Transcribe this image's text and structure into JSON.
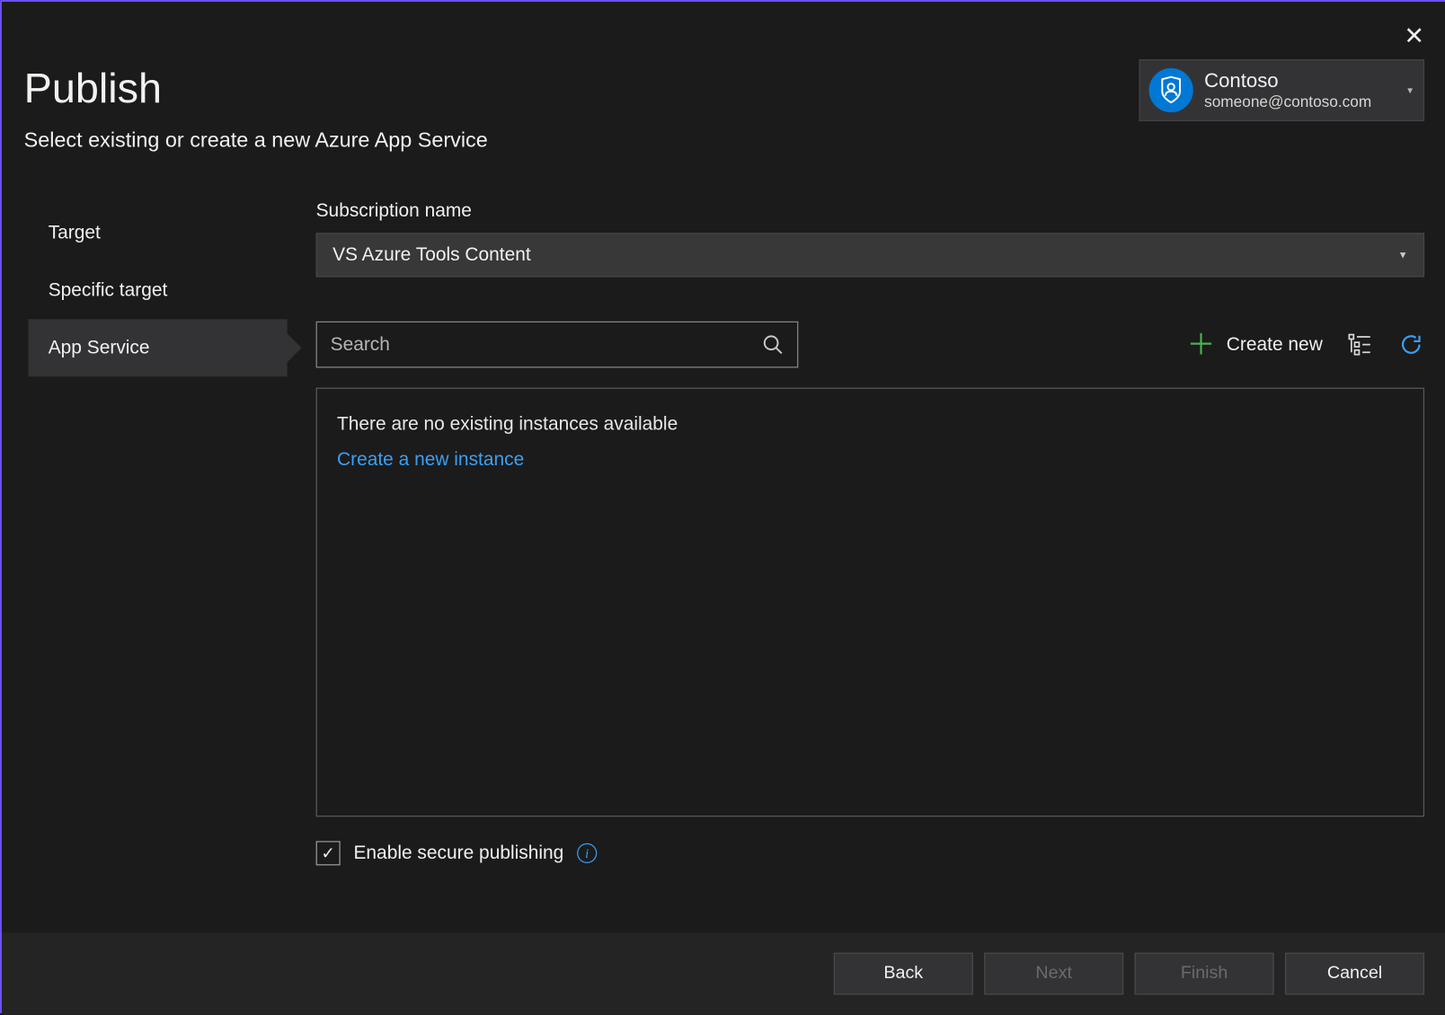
{
  "header": {
    "title": "Publish",
    "subtitle": "Select existing or create a new Azure App Service"
  },
  "account": {
    "name": "Contoso",
    "email": "someone@contoso.com"
  },
  "sidebar": {
    "items": [
      {
        "label": "Target"
      },
      {
        "label": "Specific target"
      },
      {
        "label": "App Service"
      }
    ],
    "active_index": 2
  },
  "subscription": {
    "label": "Subscription name",
    "value": "VS Azure Tools Content"
  },
  "search": {
    "placeholder": "Search"
  },
  "actions": {
    "create_new": "Create new"
  },
  "results": {
    "empty_message": "There are no existing instances available",
    "create_link": "Create a new instance"
  },
  "secure": {
    "checked": true,
    "label": "Enable secure publishing"
  },
  "footer": {
    "back": "Back",
    "next": "Next",
    "finish": "Finish",
    "cancel": "Cancel"
  }
}
